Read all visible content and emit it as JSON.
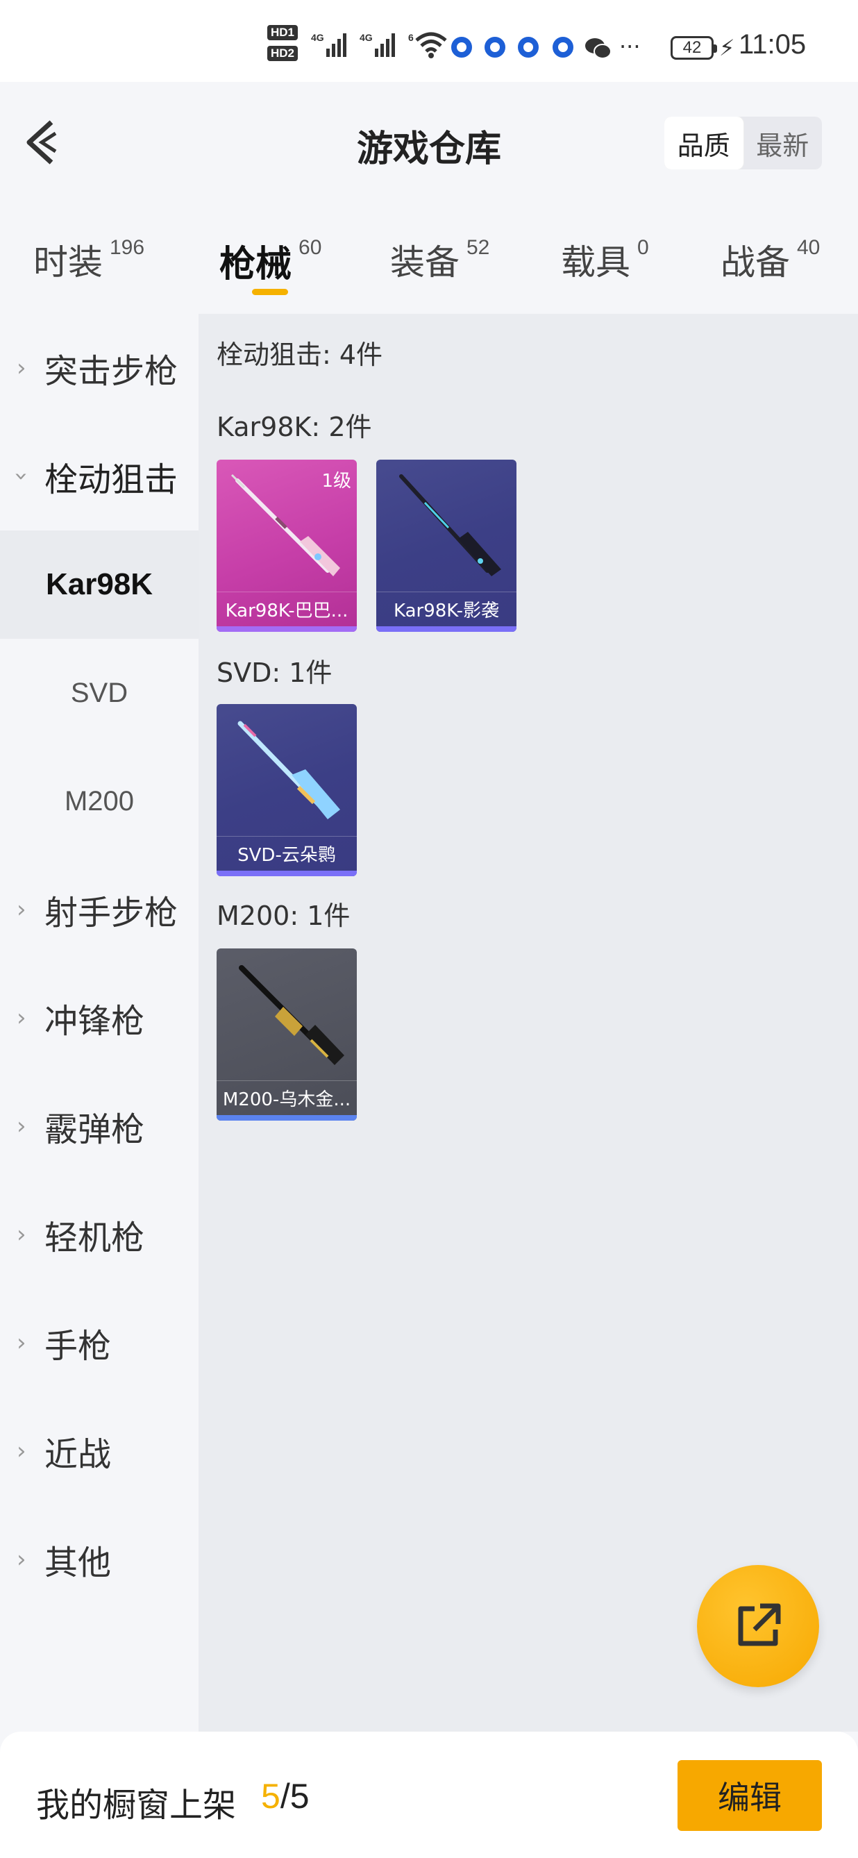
{
  "status_bar": {
    "hd_badges": [
      "HD1",
      "HD2"
    ],
    "signal_labels": [
      "4G",
      "4G",
      "6"
    ],
    "more": "···",
    "battery": "42",
    "time": "11:05",
    "icons": [
      "hd-icon",
      "signal-icon",
      "wifi-icon",
      "app-notification-icon",
      "wechat-icon",
      "more-icon",
      "battery-icon",
      "charging-icon"
    ]
  },
  "header": {
    "title": "游戏仓库",
    "sort_options": [
      "品质",
      "最新"
    ],
    "sort_selected": "品质"
  },
  "tabs": [
    {
      "label": "时装",
      "count": "196"
    },
    {
      "label": "枪械",
      "count": "60",
      "active": true
    },
    {
      "label": "装备",
      "count": "52"
    },
    {
      "label": "载具",
      "count": "0"
    },
    {
      "label": "战备",
      "count": "40"
    }
  ],
  "sidebar": {
    "items": [
      {
        "label": "突击步枪"
      },
      {
        "label": "栓动狙击",
        "expanded": true
      },
      {
        "label": "射手步枪"
      },
      {
        "label": "冲锋枪"
      },
      {
        "label": "霰弹枪"
      },
      {
        "label": "轻机枪"
      },
      {
        "label": "手枪"
      },
      {
        "label": "近战"
      },
      {
        "label": "其他"
      }
    ],
    "subitems": [
      {
        "label": "Kar98K",
        "active": true
      },
      {
        "label": "SVD"
      },
      {
        "label": "M200"
      }
    ]
  },
  "content": {
    "category_title": "栓动狙击: 4件",
    "groups": [
      {
        "title": "Kar98K: 2件",
        "items": [
          {
            "name": "Kar98K-巴巴...",
            "level": "1级",
            "rarity": "pink"
          },
          {
            "name": "Kar98K-影袭",
            "rarity": "indigo"
          }
        ]
      },
      {
        "title": "SVD: 1件",
        "items": [
          {
            "name": "SVD-云朵鹮",
            "rarity": "indigo"
          }
        ]
      },
      {
        "title": "M200: 1件",
        "items": [
          {
            "name": "M200-乌木金...",
            "rarity": "slate"
          }
        ]
      }
    ]
  },
  "fab": {
    "icon": "share-external-icon"
  },
  "bottom_bar": {
    "label": "我的橱窗上架",
    "current": "5",
    "separator_total": "/5",
    "edit_label": "编辑"
  }
}
